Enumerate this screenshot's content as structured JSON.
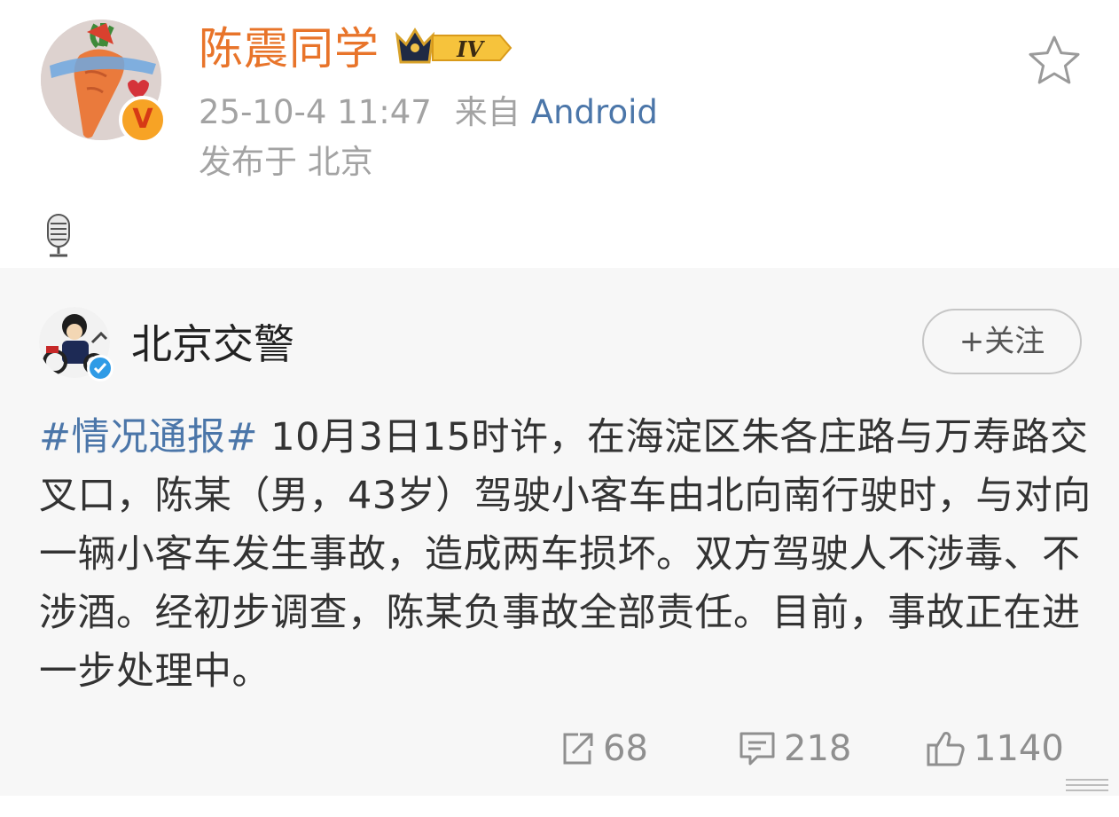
{
  "post": {
    "username": "陈震同学",
    "level": "IV",
    "time": "25-10-4 11:47",
    "from_label": "来自",
    "source": "Android",
    "location": "发布于 北京",
    "verified_mark": "V"
  },
  "repost": {
    "author": "北京交警",
    "follow_label": "+关注",
    "hashtag": "#情况通报#",
    "text": " 10月3日15时许，在海淀区朱各庄路与万寿路交叉口，陈某（男，43岁）驾驶小客车由北向南行驶时，与对向一辆小客车发生事故，造成两车损坏。双方驾驶人不涉毒、不涉酒。经初步调查，陈某负事故全部责任。目前，事故正在进一步处理中。",
    "actions": {
      "reposts": "68",
      "comments": "218",
      "likes": "1140"
    }
  },
  "colors": {
    "username": "#e8742a",
    "link": "#4b76a9",
    "meta": "#a3a3a3",
    "card_bg": "#f7f7f7"
  },
  "icons": {
    "favorite": "star-outline-icon",
    "voice": "microphone-icon",
    "repost": "share-icon",
    "comment": "comment-icon",
    "like": "thumbs-up-icon"
  }
}
